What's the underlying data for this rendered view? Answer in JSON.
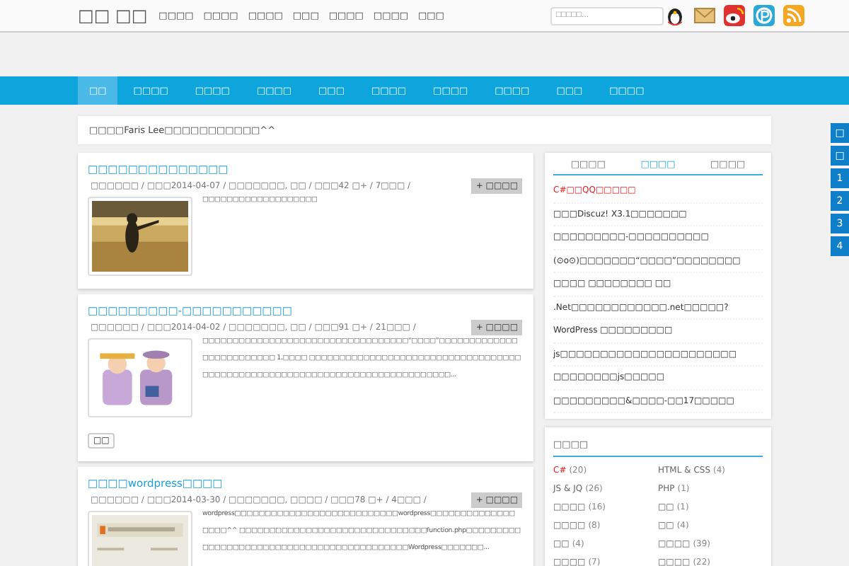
{
  "header": {
    "logo": "□□ □□",
    "links": [
      "□□□□",
      "□□□□",
      "□□□□",
      "□□□",
      "□□□□",
      "□□□□",
      "□□□"
    ],
    "search": {
      "placeholder": "□□□□□..."
    }
  },
  "nav": [
    {
      "label": "□□",
      "selected": true
    },
    {
      "label": "□□□□",
      "selected": false
    },
    {
      "label": "□□□□",
      "selected": false
    },
    {
      "label": "□□□□",
      "selected": false
    },
    {
      "label": "□□□",
      "selected": false
    },
    {
      "label": "□□□□",
      "selected": false
    },
    {
      "label": "□□□□",
      "selected": false
    },
    {
      "label": "□□□□",
      "selected": false
    },
    {
      "label": "□□□",
      "selected": false
    },
    {
      "label": "□□□□",
      "selected": false
    }
  ],
  "notice": "□□□□Faris Lee□□□□□□□□□□□^^",
  "posts": [
    {
      "title": "□□□□□□□□□□□□□□",
      "meta": "□□□□□□ / □□□2014-04-07 / □□□□□□□, □□ / □□□42 □+ / 7□□□ /",
      "more": "+ □□□□",
      "excerpt": "□□□□□□□□□□□□□□□□□□□"
    },
    {
      "title": "□□□□□□□□□-□□□□□□□□□□□",
      "meta": "□□□□□□ / □□□2014-04-02 / □□□□□□□, □□ / □□□91 □+ / 21□□□ /",
      "more": "+ □□□□",
      "excerpt": "□□□□□□□□□□□□□□□□□□□□□□□□□□□□□□□□□□“□□□□”□□□□□□□□□□□□□□□□□□□□□□□□□ 1.□□□□ □□□□□□□□□□□□□□□□□□□□□□□□□□□□□□□□□□□□□□□□□□□□□□□□□□□□□□□□□□□□□□□□□□□□□□□□□□□□...",
      "tags": [
        "□□"
      ]
    },
    {
      "title": "□□□□wordpress□□□□",
      "meta": "□□□□□□ / □□□2014-03-30 / □□□□□□□, □□□□ / □□□78 □+ / 4□□□ /",
      "more": "+ □□□□",
      "excerpt": "wordpress□□□□□□□□□□□□□□□□□□□□□□□□□□□wordpress□□□□□□□□□□□□□□ □□□□^^ □□□□□□□□□□□□□□□□□□□□□□□□□□□□□□□function.php□□□□□□□□□□□□□□□□□□□□□□□□□□□□□□□□□□□□□□□□□□□Wordpress□□□□□□□..."
    }
  ],
  "sidebar_tabs": [
    {
      "label": "□□□□",
      "selected": false
    },
    {
      "label": "□□□□",
      "selected": true
    },
    {
      "label": "□□□□",
      "selected": false
    }
  ],
  "sidebar_list": [
    {
      "text": "C#□□QQ□□□□□",
      "highlighted": true
    },
    {
      "text": "□□□Discuz! X3.1□□□□□□□",
      "highlighted": false
    },
    {
      "text": "□□□□□□□□□-□□□□□□□□□□",
      "highlighted": false
    },
    {
      "text": "(⊙o⊙)□□□□□□□“□□□□”□□□□□□□□",
      "highlighted": false
    },
    {
      "text": "□□□□ □□□□□□□□ □□",
      "highlighted": false
    },
    {
      "text": ".Net□□□□□□□□□□□□.net□□□□□?",
      "highlighted": false
    },
    {
      "text": "WordPress □□□□□□□□□",
      "highlighted": false
    },
    {
      "text": "js□□□□□□□□□□□□□□□□□□□□□□",
      "highlighted": false
    },
    {
      "text": "□□□□□□□□js□□□□□",
      "highlighted": false
    },
    {
      "text": "□□□□□□□□□&□□□□-□□17□□□□□",
      "highlighted": false
    }
  ],
  "categories": {
    "title": "□□□□",
    "items": [
      {
        "name": "C#",
        "count": "(20)",
        "highlighted": true
      },
      {
        "name": "HTML & CSS",
        "count": "(4)",
        "highlighted": false
      },
      {
        "name": "JS & JQ",
        "count": "(26)",
        "highlighted": false
      },
      {
        "name": "PHP",
        "count": "(1)",
        "highlighted": false
      },
      {
        "name": "□□□□",
        "count": "(16)",
        "highlighted": false
      },
      {
        "name": "□□",
        "count": "(1)",
        "highlighted": false
      },
      {
        "name": "□□□□",
        "count": "(8)",
        "highlighted": false
      },
      {
        "name": "□□",
        "count": "(4)",
        "highlighted": false
      },
      {
        "name": "□□",
        "count": "(4)",
        "highlighted": false
      },
      {
        "name": "□□□□",
        "count": "(39)",
        "highlighted": false
      },
      {
        "name": "□□□□",
        "count": "(7)",
        "highlighted": false
      },
      {
        "name": "□□□□",
        "count": "(22)",
        "highlighted": false
      }
    ]
  },
  "side_tabs": [
    "□",
    "□",
    "1",
    "2",
    "3",
    "4"
  ]
}
